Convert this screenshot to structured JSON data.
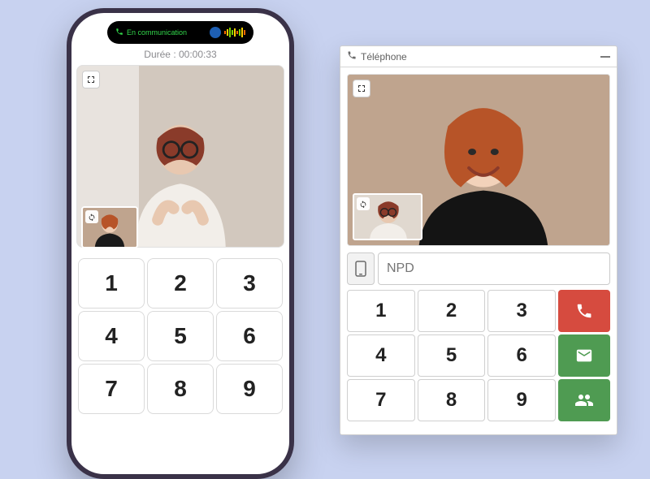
{
  "phone": {
    "island_label": "En communication",
    "duration": "Durée : 00:00:33",
    "expand_icon": "expand-icon",
    "pip_swap_icon": "swap-icon",
    "keypad": [
      "1",
      "2",
      "3",
      "4",
      "5",
      "6",
      "7",
      "8",
      "9"
    ]
  },
  "widget": {
    "title": "Téléphone",
    "expand_icon": "expand-icon",
    "pip_swap_icon": "swap-icon",
    "dial_placeholder": "NPD",
    "dial_value": "",
    "keypad": [
      "1",
      "2",
      "3",
      "4",
      "5",
      "6",
      "7",
      "8",
      "9"
    ],
    "actions": {
      "call": {
        "color": "#d64b3f",
        "icon": "phone-icon"
      },
      "mail": {
        "color": "#4f9b52",
        "icon": "mail-icon"
      },
      "group": {
        "color": "#4f9b52",
        "icon": "group-icon"
      }
    }
  }
}
